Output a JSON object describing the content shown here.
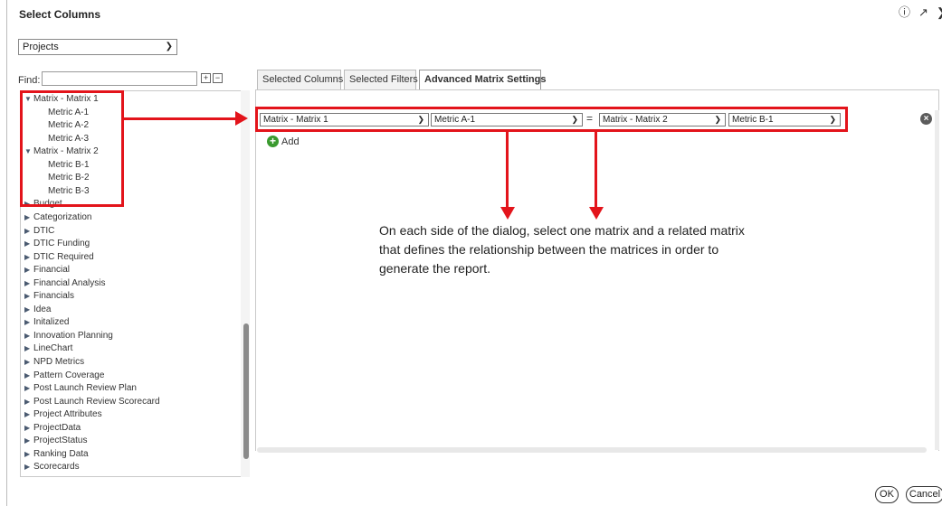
{
  "dialog": {
    "title": "Select Columns",
    "help_icon": "help-circle-icon",
    "expand_icon": "expand-icon",
    "close_icon": "close-icon"
  },
  "source": {
    "selected": "Projects"
  },
  "find": {
    "label": "Find:",
    "value": ""
  },
  "tree": {
    "items": [
      {
        "label": "Matrix - Matrix 1",
        "level": 0,
        "expanded": true
      },
      {
        "label": "Metric A-1",
        "level": 1
      },
      {
        "label": "Metric A-2",
        "level": 1
      },
      {
        "label": "Metric A-3",
        "level": 1
      },
      {
        "label": "Matrix - Matrix 2",
        "level": 0,
        "expanded": true
      },
      {
        "label": "Metric B-1",
        "level": 1
      },
      {
        "label": "Metric B-2",
        "level": 1
      },
      {
        "label": "Metric B-3",
        "level": 1
      },
      {
        "label": "Budget",
        "level": 0
      },
      {
        "label": "Categorization",
        "level": 0
      },
      {
        "label": "DTIC",
        "level": 0
      },
      {
        "label": "DTIC Funding",
        "level": 0
      },
      {
        "label": "DTIC Required",
        "level": 0
      },
      {
        "label": "Financial",
        "level": 0
      },
      {
        "label": "Financial Analysis",
        "level": 0
      },
      {
        "label": "Financials",
        "level": 0
      },
      {
        "label": "Idea",
        "level": 0
      },
      {
        "label": "Initalized",
        "level": 0
      },
      {
        "label": "Innovation Planning",
        "level": 0
      },
      {
        "label": "LineChart",
        "level": 0
      },
      {
        "label": "NPD Metrics",
        "level": 0
      },
      {
        "label": "Pattern Coverage",
        "level": 0
      },
      {
        "label": "Post Launch Review Plan",
        "level": 0
      },
      {
        "label": "Post Launch Review Scorecard",
        "level": 0
      },
      {
        "label": "Project Attributes",
        "level": 0
      },
      {
        "label": "ProjectData",
        "level": 0
      },
      {
        "label": "ProjectStatus",
        "level": 0
      },
      {
        "label": "Ranking Data",
        "level": 0
      },
      {
        "label": "Scorecards",
        "level": 0
      }
    ]
  },
  "tabs": [
    {
      "label": "Selected Columns",
      "active": false
    },
    {
      "label": "Selected Filters",
      "active": false
    },
    {
      "label": "Advanced Matrix Settings",
      "active": true
    }
  ],
  "matrix_row": {
    "left_matrix": "Matrix - Matrix 1",
    "left_metric": "Metric A-1",
    "operator": "=",
    "right_matrix": "Matrix - Matrix 2",
    "right_metric": "Metric B-1"
  },
  "add_label": "Add",
  "annotation": "On each side of the dialog, select one matrix and a related matrix that defines the relationship between the matrices in order to generate the report.",
  "buttons": {
    "ok": "OK",
    "cancel": "Cancel"
  },
  "colors": {
    "highlight": "#e3141b",
    "add": "#3a9a2f"
  }
}
